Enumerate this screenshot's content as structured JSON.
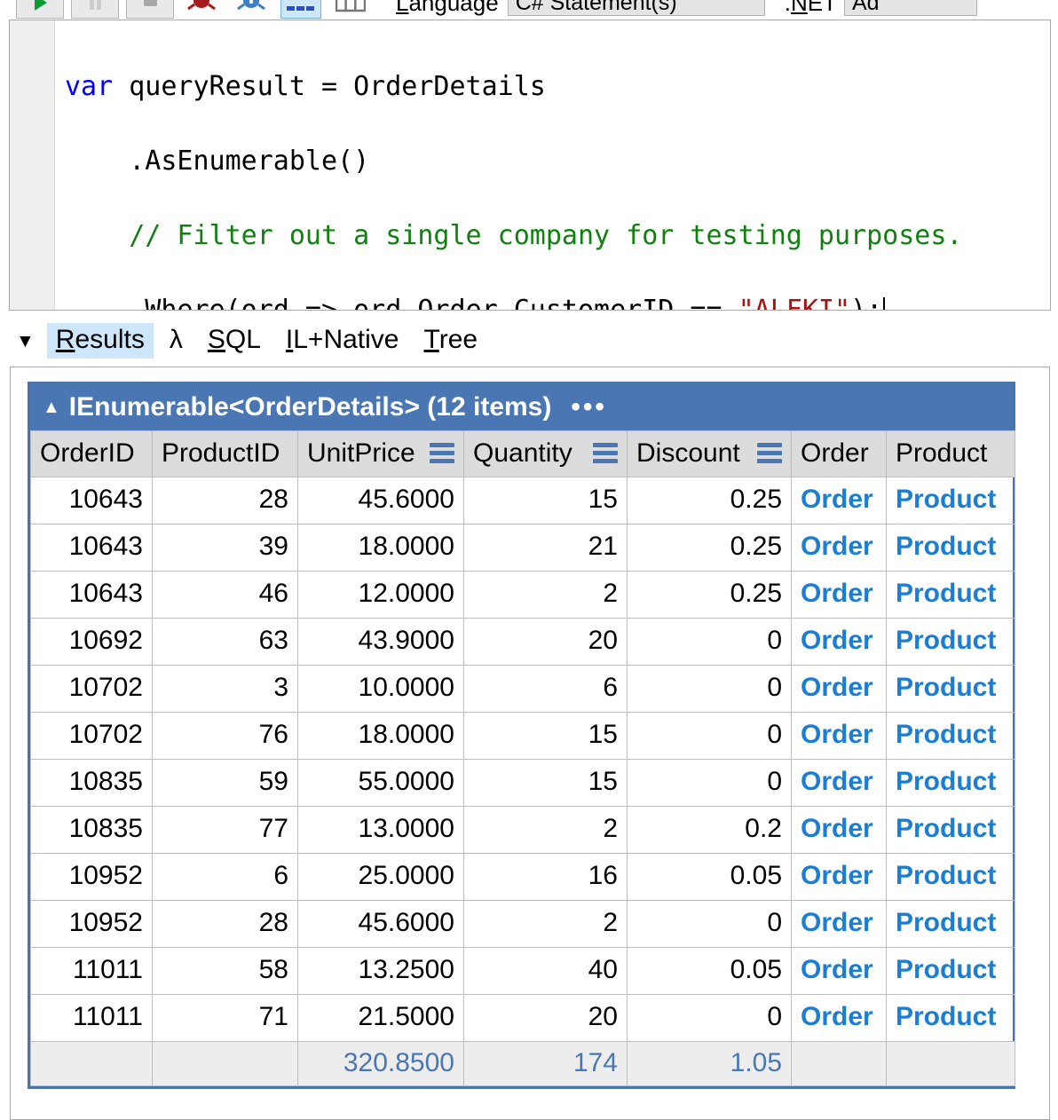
{
  "toolbar": {
    "buttons": [
      {
        "name": "run-button",
        "icon": "play-icon"
      },
      {
        "name": "pause-button",
        "icon": "pause-icon"
      },
      {
        "name": "stop-button",
        "icon": "stop-icon"
      }
    ],
    "icons": [
      {
        "name": "debug-red-icon",
        "color": "#a61c1c"
      },
      {
        "name": "debug-blue-icon",
        "color": "#3d7fc1"
      },
      {
        "name": "grid-results-icon",
        "color": "#2a4fd0",
        "selected": true
      },
      {
        "name": "columns-icon",
        "color": "#777777",
        "selected": false
      }
    ],
    "language_label": "Language",
    "language_value": "C# Statement(s)",
    "framework_label": ".NET",
    "framework_value": "Ad"
  },
  "editor": {
    "lines": [
      [
        {
          "t": "var ",
          "k": "kw"
        },
        {
          "t": "queryResult = OrderDetails",
          "k": "plain"
        }
      ],
      [
        {
          "t": "    .AsEnumerable()",
          "k": "plain"
        }
      ],
      [
        {
          "t": "    // Filter out a single company for testing purposes.",
          "k": "comment"
        }
      ],
      [
        {
          "t": "    .Where(ord => ord.Order.CustomerID == ",
          "k": "plain"
        },
        {
          "t": "\"ALFKI\"",
          "k": "string"
        },
        {
          "t": ");",
          "k": "plain"
        }
      ]
    ],
    "colors": {
      "keyword": "#0000ff",
      "plain": "#000000",
      "comment": "#108010",
      "string": "#a31515"
    }
  },
  "tabs": {
    "collapse_icon": "▼",
    "items": [
      {
        "label": "Results",
        "accel": "R",
        "active": true
      },
      {
        "label": "λ",
        "accel": "",
        "active": false
      },
      {
        "label": "SQL",
        "accel": "S",
        "active": false
      },
      {
        "label": "IL+Native",
        "accel": "I",
        "active": false
      },
      {
        "label": "Tree",
        "accel": "T",
        "active": false
      }
    ]
  },
  "results": {
    "header": {
      "collapse_icon": "▲",
      "title": "IEnumerable<OrderDetails> (12 items)",
      "menu_dots": "•••",
      "bg_color": "#4a77b4"
    },
    "columns": [
      {
        "label": "OrderID",
        "bars": false,
        "align": "right"
      },
      {
        "label": "ProductID",
        "bars": false,
        "align": "right"
      },
      {
        "label": "UnitPrice",
        "bars": true,
        "align": "right"
      },
      {
        "label": "Quantity",
        "bars": true,
        "align": "right"
      },
      {
        "label": "Discount",
        "bars": true,
        "align": "right"
      },
      {
        "label": "Order",
        "bars": false,
        "align": "left"
      },
      {
        "label": "Product",
        "bars": false,
        "align": "left"
      }
    ],
    "rows": [
      {
        "OrderID": "10643",
        "ProductID": "28",
        "UnitPrice": "45.6000",
        "Quantity": "15",
        "Discount": "0.25",
        "Order": "Order",
        "Product": "Product"
      },
      {
        "OrderID": "10643",
        "ProductID": "39",
        "UnitPrice": "18.0000",
        "Quantity": "21",
        "Discount": "0.25",
        "Order": "Order",
        "Product": "Product"
      },
      {
        "OrderID": "10643",
        "ProductID": "46",
        "UnitPrice": "12.0000",
        "Quantity": "2",
        "Discount": "0.25",
        "Order": "Order",
        "Product": "Product"
      },
      {
        "OrderID": "10692",
        "ProductID": "63",
        "UnitPrice": "43.9000",
        "Quantity": "20",
        "Discount": "0",
        "Order": "Order",
        "Product": "Product"
      },
      {
        "OrderID": "10702",
        "ProductID": "3",
        "UnitPrice": "10.0000",
        "Quantity": "6",
        "Discount": "0",
        "Order": "Order",
        "Product": "Product"
      },
      {
        "OrderID": "10702",
        "ProductID": "76",
        "UnitPrice": "18.0000",
        "Quantity": "15",
        "Discount": "0",
        "Order": "Order",
        "Product": "Product"
      },
      {
        "OrderID": "10835",
        "ProductID": "59",
        "UnitPrice": "55.0000",
        "Quantity": "15",
        "Discount": "0",
        "Order": "Order",
        "Product": "Product"
      },
      {
        "OrderID": "10835",
        "ProductID": "77",
        "UnitPrice": "13.0000",
        "Quantity": "2",
        "Discount": "0.2",
        "Order": "Order",
        "Product": "Product"
      },
      {
        "OrderID": "10952",
        "ProductID": "6",
        "UnitPrice": "25.0000",
        "Quantity": "16",
        "Discount": "0.05",
        "Order": "Order",
        "Product": "Product"
      },
      {
        "OrderID": "10952",
        "ProductID": "28",
        "UnitPrice": "45.6000",
        "Quantity": "2",
        "Discount": "0",
        "Order": "Order",
        "Product": "Product"
      },
      {
        "OrderID": "11011",
        "ProductID": "58",
        "UnitPrice": "13.2500",
        "Quantity": "40",
        "Discount": "0.05",
        "Order": "Order",
        "Product": "Product"
      },
      {
        "OrderID": "11011",
        "ProductID": "71",
        "UnitPrice": "21.5000",
        "Quantity": "20",
        "Discount": "0",
        "Order": "Order",
        "Product": "Product"
      }
    ],
    "totals": {
      "OrderID": "",
      "ProductID": "",
      "UnitPrice": "320.8500",
      "Quantity": "174",
      "Discount": "1.05",
      "Order": "",
      "Product": ""
    },
    "link_color": "#1a7fd4",
    "total_color": "#4a77b4"
  }
}
